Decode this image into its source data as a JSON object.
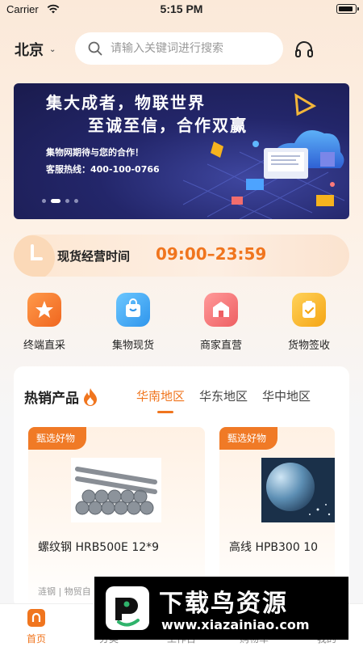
{
  "status_bar": {
    "carrier": "Carrier",
    "time": "5:15 PM"
  },
  "header": {
    "city": "北京",
    "search_placeholder": "请输入关键词进行搜索"
  },
  "banner": {
    "headline_1": "集大成者，物联世界",
    "headline_2": "至诚至信，合作双赢",
    "text_1": "集物网期待与您的合作！",
    "text_2": "客服热线：400-100-0766",
    "page_count": 4,
    "active_page": 2
  },
  "hours": {
    "label": "现货经营时间",
    "value": "09:00–23:59"
  },
  "quick_entries": [
    {
      "label": "终端直采",
      "icon": "star-icon",
      "color": "#f2762a"
    },
    {
      "label": "集物现货",
      "icon": "bag-icon",
      "color": "#3aa6ef"
    },
    {
      "label": "商家直营",
      "icon": "store-icon",
      "color": "#f06b6b"
    },
    {
      "label": "货物签收",
      "icon": "clipboard-check-icon",
      "color": "#f6b31e"
    }
  ],
  "hot_products": {
    "title": "热销产品",
    "tabs": [
      "华南地区",
      "华东地区",
      "华中地区"
    ],
    "active_tab": 0,
    "items": [
      {
        "tag": "甄选好物",
        "name": "螺纹钢 HRB500E 12*9",
        "meta": "涟钢 | 物贸自"
      },
      {
        "tag": "甄选好物",
        "name": "高线 HPB300 10",
        "meta": ""
      }
    ]
  },
  "tab_bar": {
    "items": [
      {
        "label": "首页",
        "active": true
      },
      {
        "label": "分类",
        "active": false
      },
      {
        "label": "工作台",
        "active": false
      },
      {
        "label": "购物车",
        "active": false
      },
      {
        "label": "我的",
        "active": false
      }
    ]
  },
  "watermark": {
    "title": "下载鸟资源",
    "url": "www.xiazainiao.com"
  },
  "colors": {
    "accent": "#f0751e",
    "banner_bg": "#23266a"
  }
}
